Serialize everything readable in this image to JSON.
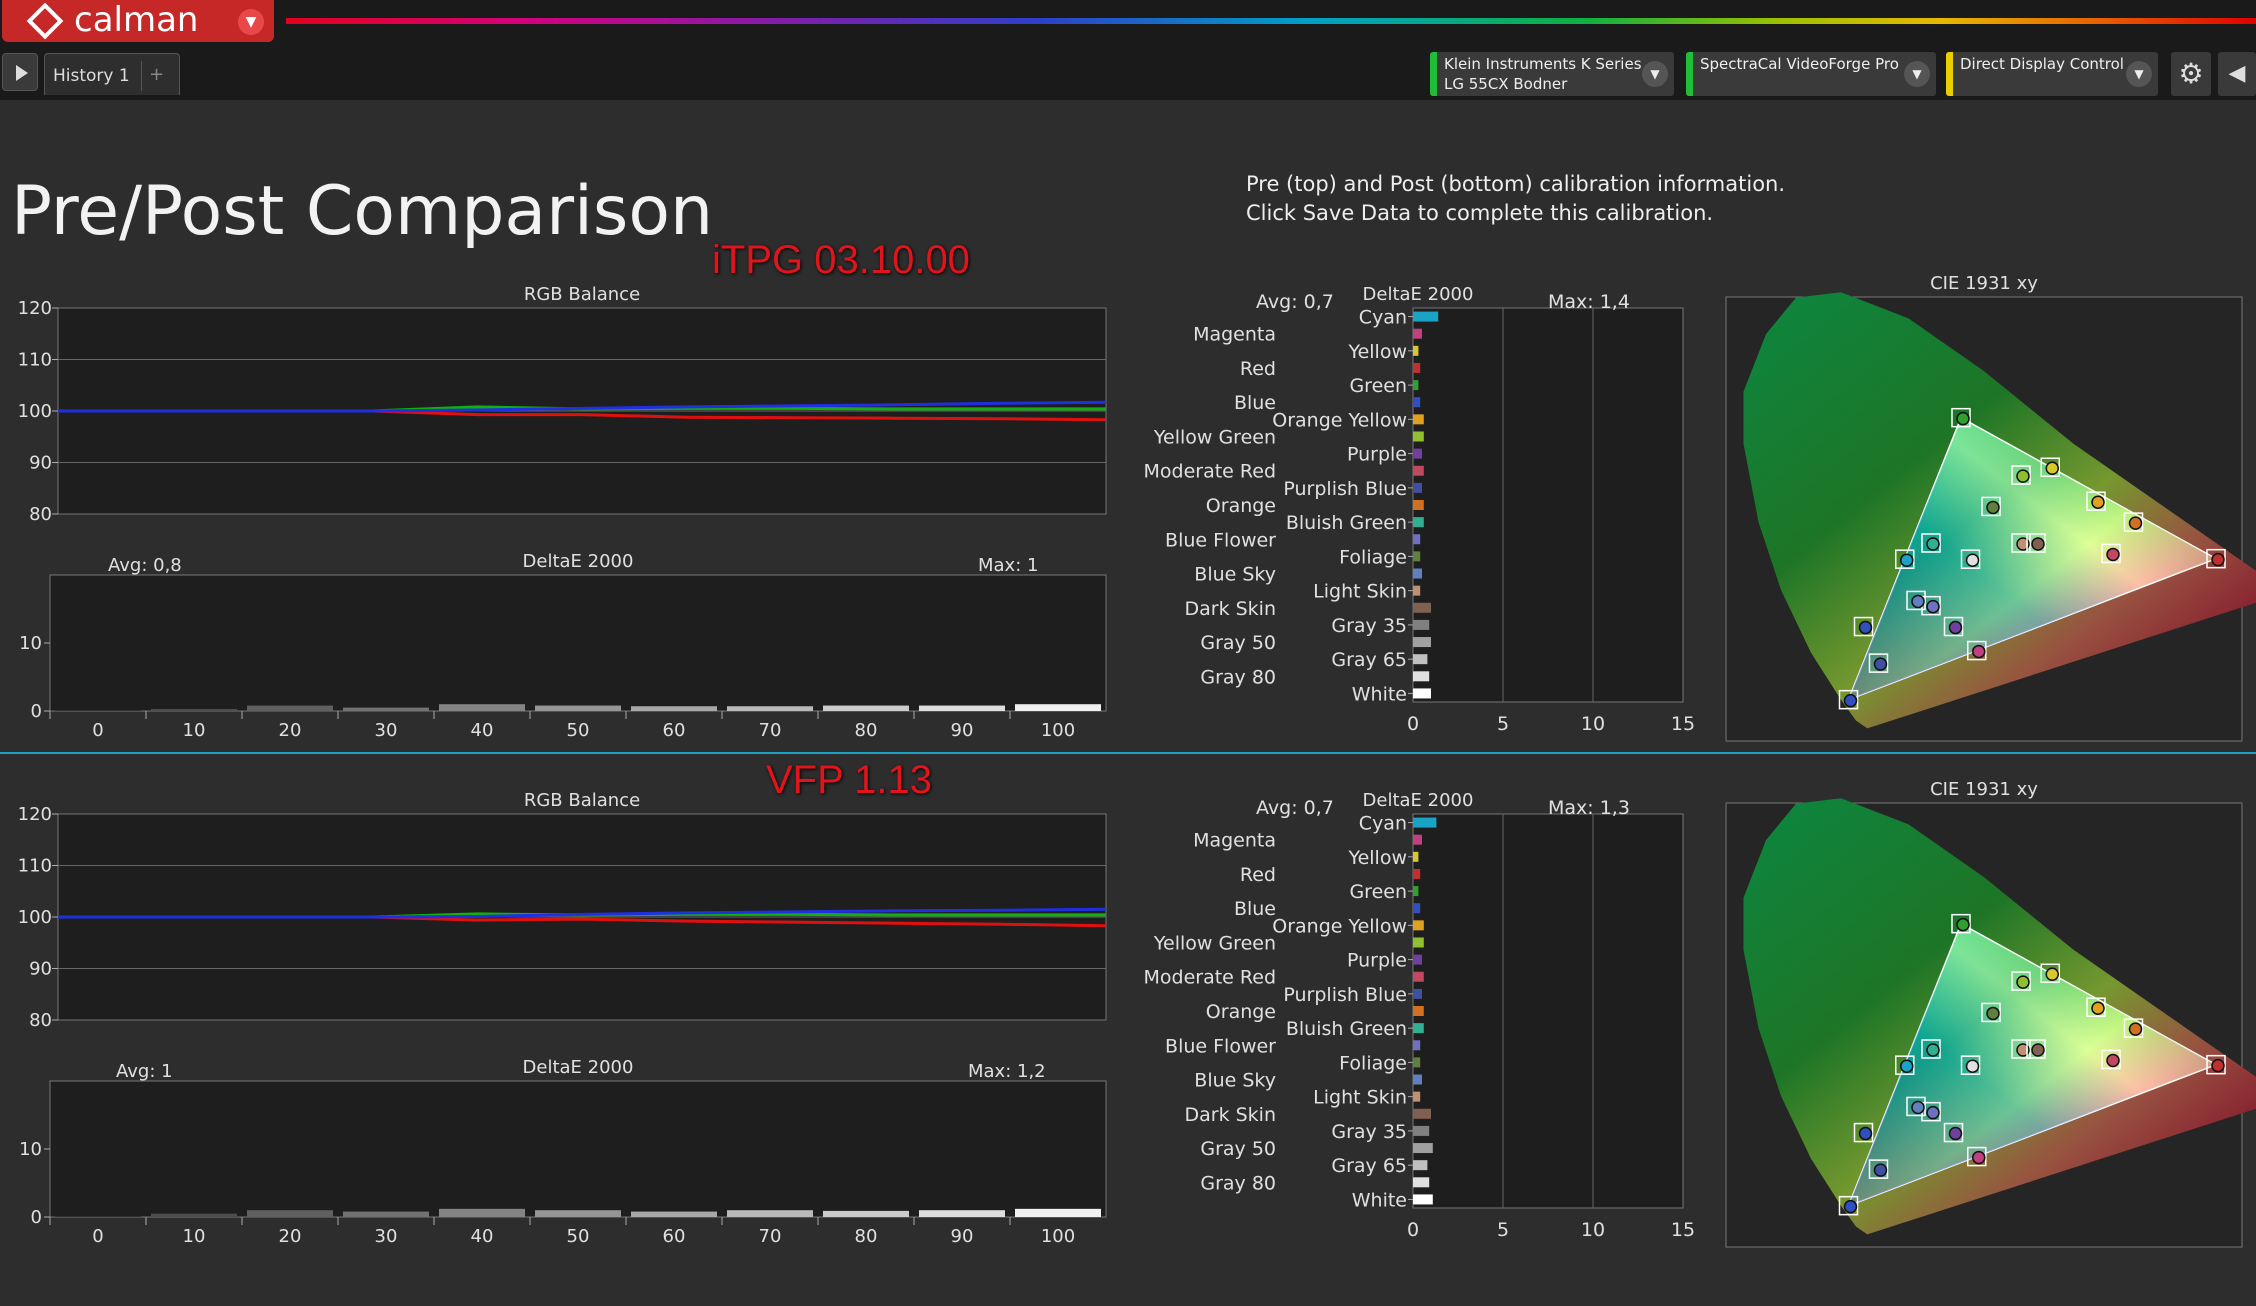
{
  "app": {
    "name": "calman"
  },
  "tabs": [
    {
      "label": "History 1"
    }
  ],
  "devices": [
    {
      "line1": "Klein Instruments K Series",
      "line2": "LG 55CX Bodner",
      "color": "#1fbf3a"
    },
    {
      "line1": "SpectraCal VideoForge Pro",
      "line2": "",
      "color": "#1fbf3a"
    },
    {
      "line1": "Direct Display Control",
      "line2": "",
      "color": "#e8d000"
    }
  ],
  "page": {
    "title": "Pre/Post Comparison",
    "info_line1": "Pre (top) and Post (bottom) calibration information.",
    "info_line2": "Click Save Data to complete this calibration."
  },
  "pre": {
    "label": "iTPG 03.10.00",
    "rgb_title": "RGB Balance",
    "de_title": "DeltaE 2000",
    "gray_avg": "Avg: 0,8",
    "gray_max": "Max: 1",
    "cc_avg": "Avg: 0,7",
    "cc_max": "Max: 1,4",
    "cie_title": "CIE 1931 xy"
  },
  "post": {
    "label": "VFP 1.13",
    "rgb_title": "RGB Balance",
    "de_title": "DeltaE 2000",
    "gray_avg": "Avg: 1",
    "gray_max": "Max: 1,2",
    "cc_avg": "Avg: 0,7",
    "cc_max": "Max: 1,3",
    "cie_title": "CIE 1931 xy"
  },
  "chart_data": [
    {
      "type": "line",
      "title": "RGB Balance",
      "panel": "pre",
      "x": [
        0,
        10,
        20,
        30,
        40,
        50,
        60,
        70,
        80,
        90,
        100
      ],
      "ylim": [
        80,
        120
      ],
      "yticks": [
        80,
        90,
        100,
        110,
        120
      ],
      "series": [
        {
          "color": "#e01010",
          "values": [
            100,
            100,
            100,
            100,
            99.3,
            99.3,
            98.8,
            98.7,
            98.6,
            98.5,
            98.3
          ]
        },
        {
          "color": "#10b010",
          "values": [
            100,
            100,
            100,
            100,
            100.8,
            100.4,
            100.5,
            100.5,
            100.4,
            100.4,
            100.4
          ]
        },
        {
          "color": "#2030e0",
          "values": [
            100,
            100,
            100,
            100,
            100.2,
            100.5,
            100.8,
            101.0,
            101.2,
            101.5,
            101.7
          ]
        }
      ]
    },
    {
      "type": "bar",
      "title": "DeltaE 2000",
      "panel": "pre",
      "categories": [
        "0",
        "10",
        "20",
        "30",
        "40",
        "50",
        "60",
        "70",
        "80",
        "90",
        "100"
      ],
      "values": [
        0.1,
        0.3,
        0.8,
        0.5,
        1.0,
        0.8,
        0.7,
        0.7,
        0.8,
        0.8,
        1.0
      ],
      "ylim": [
        0,
        20
      ],
      "yticks": [
        0,
        10
      ]
    },
    {
      "type": "bar",
      "title": "DeltaE 2000",
      "panel": "pre",
      "orientation": "horizontal",
      "categories": [
        "Cyan",
        "Magenta",
        "Yellow",
        "Red",
        "Green",
        "Blue",
        "Orange Yellow",
        "Yellow Green",
        "Purple",
        "Moderate Red",
        "Purplish Blue",
        "Orange",
        "Bluish Green",
        "Blue Flower",
        "Foliage",
        "Blue Sky",
        "Light Skin",
        "Dark Skin",
        "Gray 35",
        "Gray 50",
        "Gray 65",
        "Gray 80",
        "White"
      ],
      "colors": [
        "#1aa3c4",
        "#c04080",
        "#d8c830",
        "#c03030",
        "#30a030",
        "#3050c0",
        "#e0a020",
        "#90c030",
        "#7040a0",
        "#c04860",
        "#4050a0",
        "#d07020",
        "#30b090",
        "#7070c0",
        "#608040",
        "#6080c0",
        "#c09070",
        "#806050",
        "#808080",
        "#a0a0a0",
        "#c0c0c0",
        "#e0e0e0",
        "#ffffff"
      ],
      "values": [
        1.4,
        0.5,
        0.3,
        0.4,
        0.3,
        0.4,
        0.6,
        0.6,
        0.5,
        0.6,
        0.5,
        0.6,
        0.6,
        0.4,
        0.4,
        0.5,
        0.4,
        1.0,
        0.9,
        1.0,
        0.8,
        0.9,
        1.0
      ],
      "xlim": [
        0,
        15
      ],
      "xticks": [
        0,
        5,
        10,
        15
      ]
    },
    {
      "type": "scatter",
      "title": "CIE 1931 xy",
      "panel": "pre",
      "xlim": [
        0,
        0.8
      ],
      "ylim": [
        0,
        0.9
      ],
      "gamut": [
        [
          0.64,
          0.33
        ],
        [
          0.3,
          0.6
        ],
        [
          0.15,
          0.06
        ]
      ],
      "points": [
        {
          "x": 0.225,
          "y": 0.329,
          "color": "#1aa3c4"
        },
        {
          "x": 0.321,
          "y": 0.154,
          "color": "#c04080"
        },
        {
          "x": 0.419,
          "y": 0.505,
          "color": "#d8c830"
        },
        {
          "x": 0.64,
          "y": 0.33,
          "color": "#c03030"
        },
        {
          "x": 0.3,
          "y": 0.6,
          "color": "#30a030"
        },
        {
          "x": 0.15,
          "y": 0.06,
          "color": "#3050c0"
        },
        {
          "x": 0.48,
          "y": 0.44,
          "color": "#e0a020"
        },
        {
          "x": 0.38,
          "y": 0.49,
          "color": "#90c030"
        },
        {
          "x": 0.29,
          "y": 0.2,
          "color": "#7040a0"
        },
        {
          "x": 0.5,
          "y": 0.34,
          "color": "#c04860"
        },
        {
          "x": 0.19,
          "y": 0.13,
          "color": "#4050a0"
        },
        {
          "x": 0.53,
          "y": 0.4,
          "color": "#d07020"
        },
        {
          "x": 0.26,
          "y": 0.36,
          "color": "#30b090"
        },
        {
          "x": 0.26,
          "y": 0.24,
          "color": "#7070c0"
        },
        {
          "x": 0.34,
          "y": 0.43,
          "color": "#608040"
        },
        {
          "x": 0.24,
          "y": 0.25,
          "color": "#6080c0"
        },
        {
          "x": 0.38,
          "y": 0.36,
          "color": "#c09070"
        },
        {
          "x": 0.4,
          "y": 0.36,
          "color": "#806050"
        },
        {
          "x": 0.3127,
          "y": 0.329,
          "color": "#e0e0e0"
        },
        {
          "x": 0.17,
          "y": 0.2,
          "color": "#3050c0"
        }
      ]
    },
    {
      "type": "line",
      "title": "RGB Balance",
      "panel": "post",
      "x": [
        0,
        10,
        20,
        30,
        40,
        50,
        60,
        70,
        80,
        90,
        100
      ],
      "ylim": [
        80,
        120
      ],
      "yticks": [
        80,
        90,
        100,
        110,
        120
      ],
      "series": [
        {
          "color": "#e01010",
          "values": [
            100,
            100,
            100,
            100,
            99.4,
            99.6,
            99.2,
            99.0,
            98.8,
            98.6,
            98.3
          ]
        },
        {
          "color": "#10b010",
          "values": [
            100,
            100,
            100,
            100,
            100.6,
            100.4,
            100.5,
            100.5,
            100.4,
            100.4,
            100.4
          ]
        },
        {
          "color": "#2030e0",
          "values": [
            100,
            100,
            100,
            100,
            100.1,
            100.5,
            100.8,
            101.0,
            101.2,
            101.3,
            101.5
          ]
        }
      ]
    },
    {
      "type": "bar",
      "title": "DeltaE 2000",
      "panel": "post",
      "categories": [
        "0",
        "10",
        "20",
        "30",
        "40",
        "50",
        "60",
        "70",
        "80",
        "90",
        "100"
      ],
      "values": [
        0.1,
        0.5,
        1.0,
        0.8,
        1.2,
        1.0,
        0.8,
        1.0,
        0.9,
        1.0,
        1.2
      ],
      "ylim": [
        0,
        20
      ],
      "yticks": [
        0,
        10
      ]
    },
    {
      "type": "bar",
      "title": "DeltaE 2000",
      "panel": "post",
      "orientation": "horizontal",
      "categories": [
        "Cyan",
        "Magenta",
        "Yellow",
        "Red",
        "Green",
        "Blue",
        "Orange Yellow",
        "Yellow Green",
        "Purple",
        "Moderate Red",
        "Purplish Blue",
        "Orange",
        "Bluish Green",
        "Blue Flower",
        "Foliage",
        "Blue Sky",
        "Light Skin",
        "Dark Skin",
        "Gray 35",
        "Gray 50",
        "Gray 65",
        "Gray 80",
        "White"
      ],
      "colors": [
        "#1aa3c4",
        "#c04080",
        "#d8c830",
        "#c03030",
        "#30a030",
        "#3050c0",
        "#e0a020",
        "#90c030",
        "#7040a0",
        "#c04860",
        "#4050a0",
        "#d07020",
        "#30b090",
        "#7070c0",
        "#608040",
        "#6080c0",
        "#c09070",
        "#806050",
        "#808080",
        "#a0a0a0",
        "#c0c0c0",
        "#e0e0e0",
        "#ffffff"
      ],
      "values": [
        1.3,
        0.5,
        0.3,
        0.4,
        0.3,
        0.4,
        0.6,
        0.6,
        0.5,
        0.6,
        0.5,
        0.6,
        0.6,
        0.4,
        0.4,
        0.5,
        0.4,
        1.0,
        0.9,
        1.1,
        0.8,
        0.9,
        1.1
      ],
      "xlim": [
        0,
        15
      ],
      "xticks": [
        0,
        5,
        10,
        15
      ]
    },
    {
      "type": "scatter",
      "title": "CIE 1931 xy",
      "panel": "post",
      "xlim": [
        0,
        0.8
      ],
      "ylim": [
        0,
        0.9
      ],
      "gamut": [
        [
          0.64,
          0.33
        ],
        [
          0.3,
          0.6
        ],
        [
          0.15,
          0.06
        ]
      ],
      "points": [
        {
          "x": 0.225,
          "y": 0.329,
          "color": "#1aa3c4"
        },
        {
          "x": 0.321,
          "y": 0.154,
          "color": "#c04080"
        },
        {
          "x": 0.419,
          "y": 0.505,
          "color": "#d8c830"
        },
        {
          "x": 0.64,
          "y": 0.33,
          "color": "#c03030"
        },
        {
          "x": 0.3,
          "y": 0.6,
          "color": "#30a030"
        },
        {
          "x": 0.15,
          "y": 0.06,
          "color": "#3050c0"
        },
        {
          "x": 0.48,
          "y": 0.44,
          "color": "#e0a020"
        },
        {
          "x": 0.38,
          "y": 0.49,
          "color": "#90c030"
        },
        {
          "x": 0.29,
          "y": 0.2,
          "color": "#7040a0"
        },
        {
          "x": 0.5,
          "y": 0.34,
          "color": "#c04860"
        },
        {
          "x": 0.19,
          "y": 0.13,
          "color": "#4050a0"
        },
        {
          "x": 0.53,
          "y": 0.4,
          "color": "#d07020"
        },
        {
          "x": 0.26,
          "y": 0.36,
          "color": "#30b090"
        },
        {
          "x": 0.26,
          "y": 0.24,
          "color": "#7070c0"
        },
        {
          "x": 0.34,
          "y": 0.43,
          "color": "#608040"
        },
        {
          "x": 0.24,
          "y": 0.25,
          "color": "#6080c0"
        },
        {
          "x": 0.38,
          "y": 0.36,
          "color": "#c09070"
        },
        {
          "x": 0.4,
          "y": 0.36,
          "color": "#806050"
        },
        {
          "x": 0.3127,
          "y": 0.329,
          "color": "#e0e0e0"
        },
        {
          "x": 0.17,
          "y": 0.2,
          "color": "#3050c0"
        }
      ]
    }
  ]
}
